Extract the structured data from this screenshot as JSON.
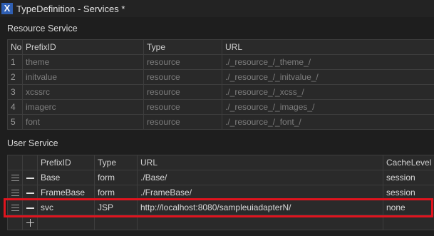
{
  "window": {
    "title": "TypeDefinition - Services *",
    "icon": "x-logo-icon"
  },
  "resource_service": {
    "label": "Resource Service",
    "columns": [
      "No",
      "PrefixID",
      "Type",
      "URL"
    ],
    "rows": [
      {
        "no": "1",
        "prefix": "theme",
        "type": "resource",
        "url": "./_resource_/_theme_/"
      },
      {
        "no": "2",
        "prefix": "initvalue",
        "type": "resource",
        "url": "./_resource_/_initvalue_/"
      },
      {
        "no": "3",
        "prefix": "xcssrc",
        "type": "resource",
        "url": "./_resource_/_xcss_/"
      },
      {
        "no": "4",
        "prefix": "imagerc",
        "type": "resource",
        "url": "./_resource_/_images_/"
      },
      {
        "no": "5",
        "prefix": "font",
        "type": "resource",
        "url": "./_resource_/_font_/"
      }
    ]
  },
  "user_service": {
    "label": "User Service",
    "columns": [
      "PrefixID",
      "Type",
      "URL",
      "CacheLevel"
    ],
    "rows": [
      {
        "prefix": "Base",
        "type": "form",
        "url": "./Base/",
        "cache": "session"
      },
      {
        "prefix": "FrameBase",
        "type": "form",
        "url": "./FrameBase/",
        "cache": "session"
      },
      {
        "prefix": "svc",
        "type": "JSP",
        "url": "http://localhost:8080/sampleuiadapterN/",
        "cache": "none"
      }
    ],
    "highlight_color": "#e0141e"
  }
}
